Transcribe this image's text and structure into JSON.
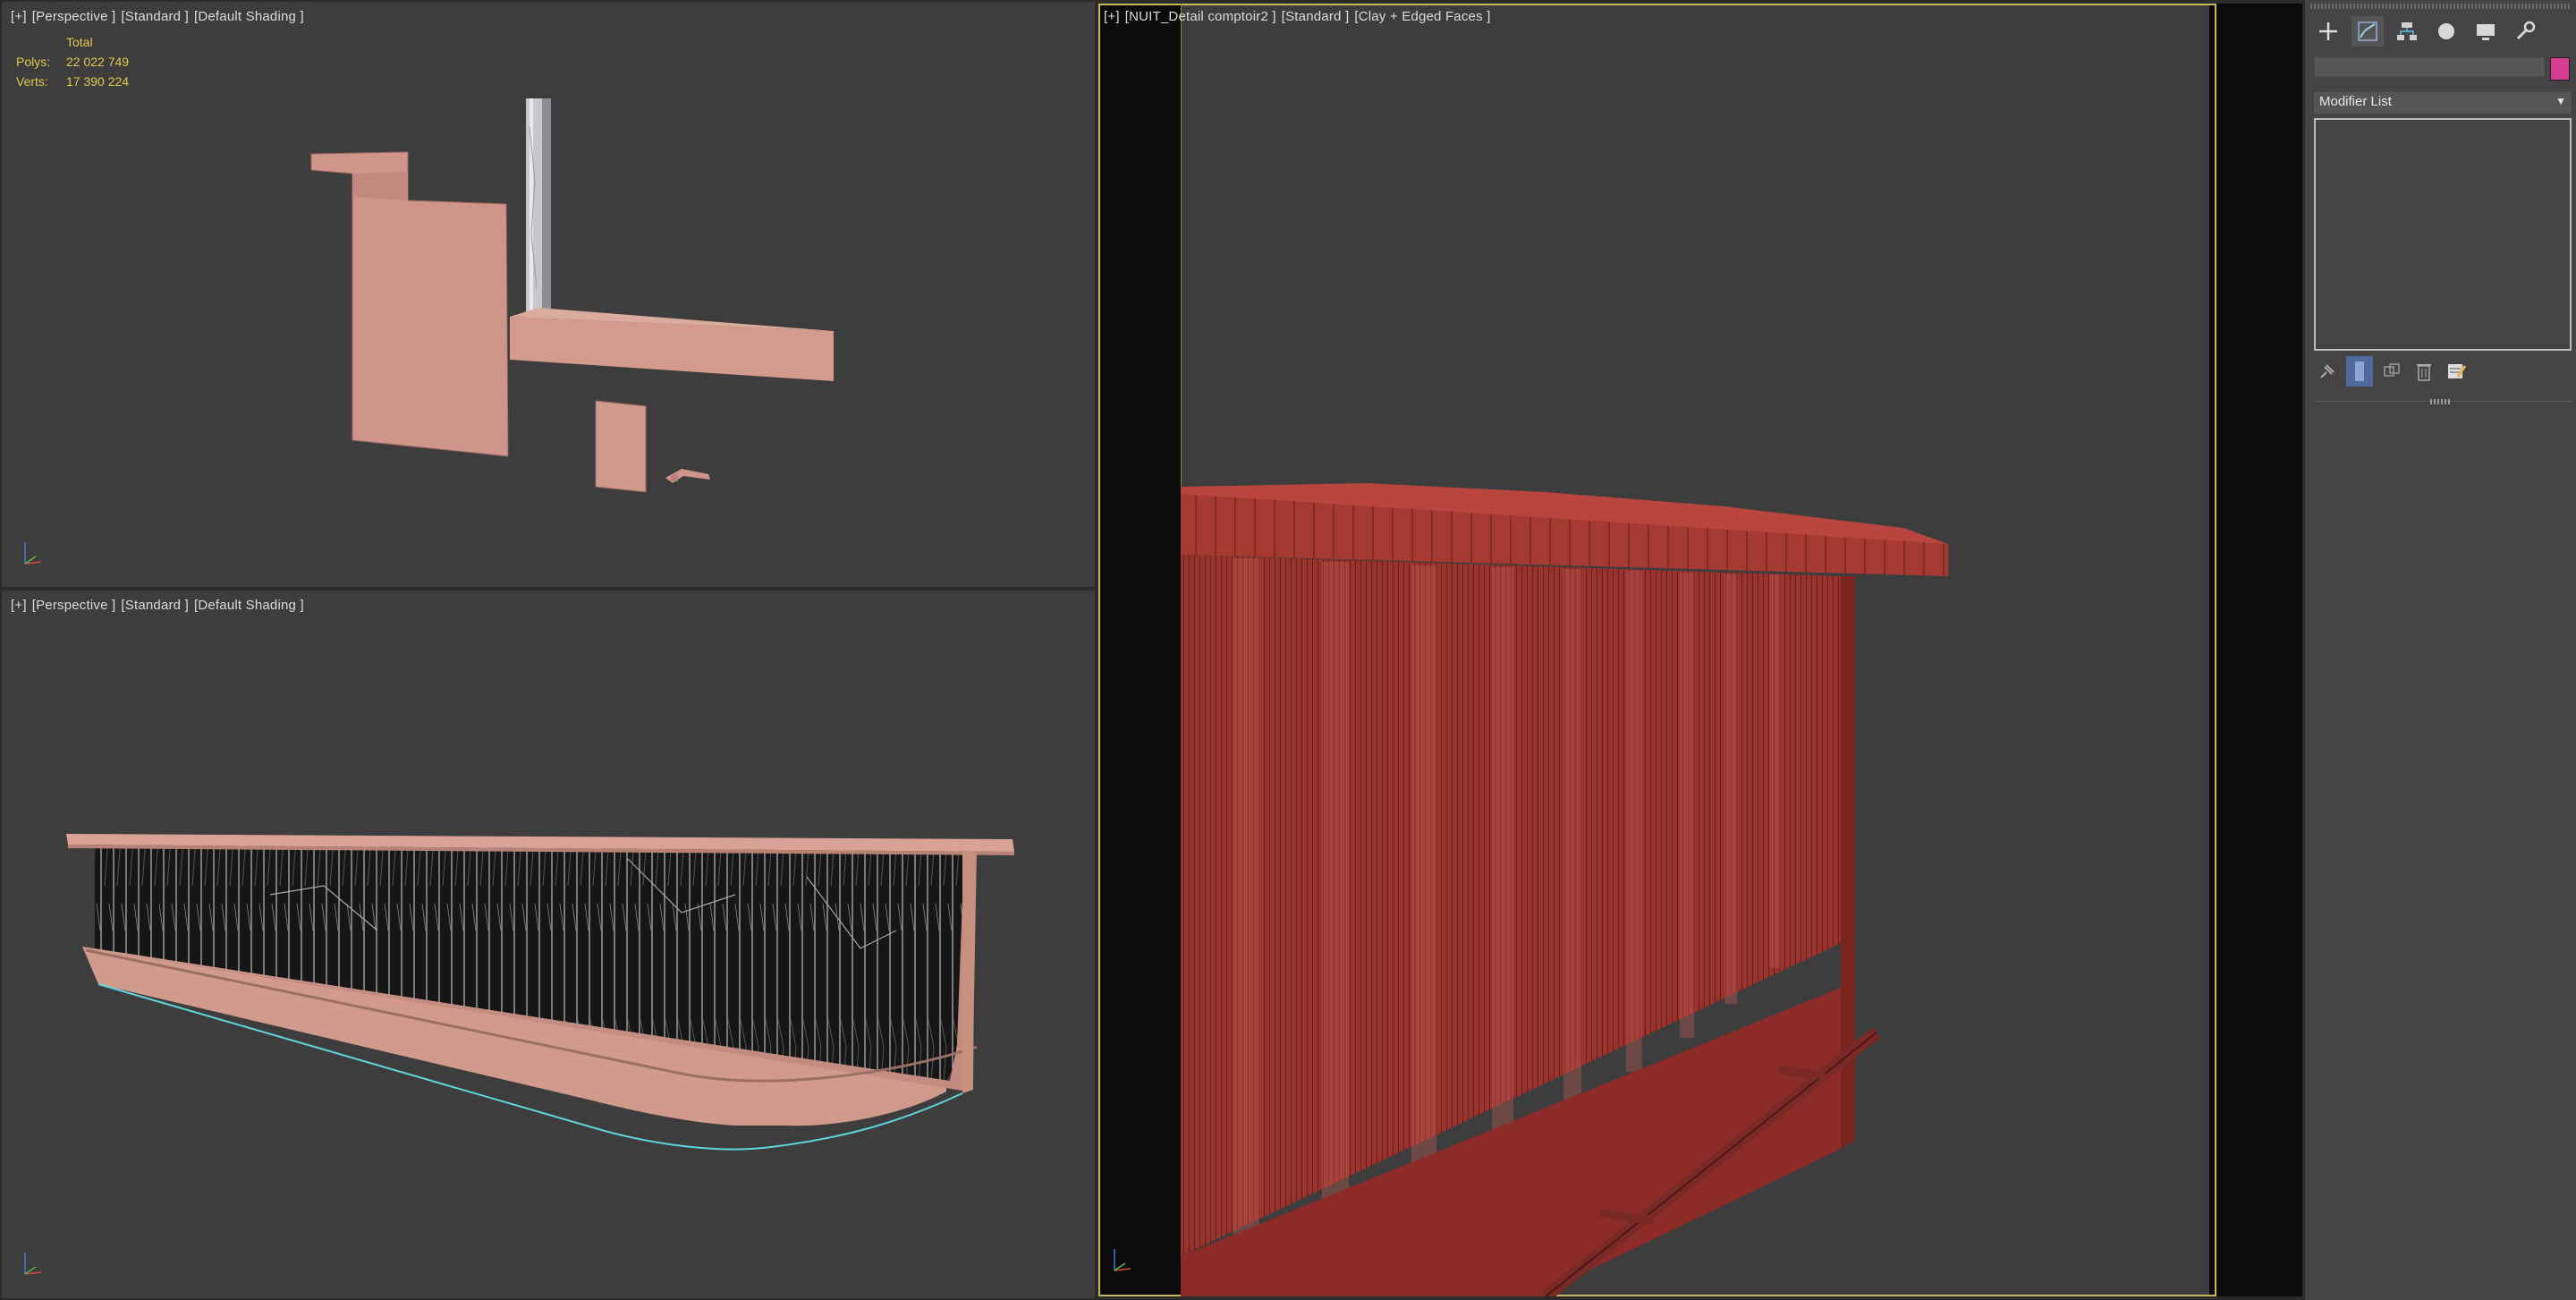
{
  "viewports": {
    "top_left": {
      "label_parts": [
        "[+]",
        "[Perspective ]",
        "[Standard ]",
        "[Default Shading ]"
      ],
      "stats": {
        "total_label": "Total",
        "polys_label": "Polys:",
        "polys_value": "22 022 749",
        "verts_label": "Verts:",
        "verts_value": "17 390 224"
      }
    },
    "bottom_left": {
      "label_parts": [
        "[+]",
        "[Perspective ]",
        "[Standard ]",
        "[Default Shading ]"
      ]
    },
    "right": {
      "label_parts": [
        "[+]",
        "[NUIT_Detail comptoir2 ]",
        "[Standard ]",
        "[Clay + Edged Faces ]"
      ]
    }
  },
  "command_panel": {
    "tabs": [
      "create-icon",
      "modify-icon",
      "hierarchy-icon",
      "motion-icon",
      "display-icon",
      "utilities-icon"
    ],
    "name_value": "",
    "object_color": "#d63c8f",
    "modifier_list_label": "Modifier List",
    "stack_tools": [
      "pin-stack-icon",
      "show-end-result-icon",
      "make-unique-icon",
      "remove-modifier-icon",
      "configure-sets-icon"
    ]
  },
  "colors": {
    "viewport_bg": "#3d3d3d",
    "active_border": "#c7b95a",
    "clay": "#d4988a",
    "wire_red": "#8a2e2a",
    "stats_text": "#e0c94b"
  }
}
